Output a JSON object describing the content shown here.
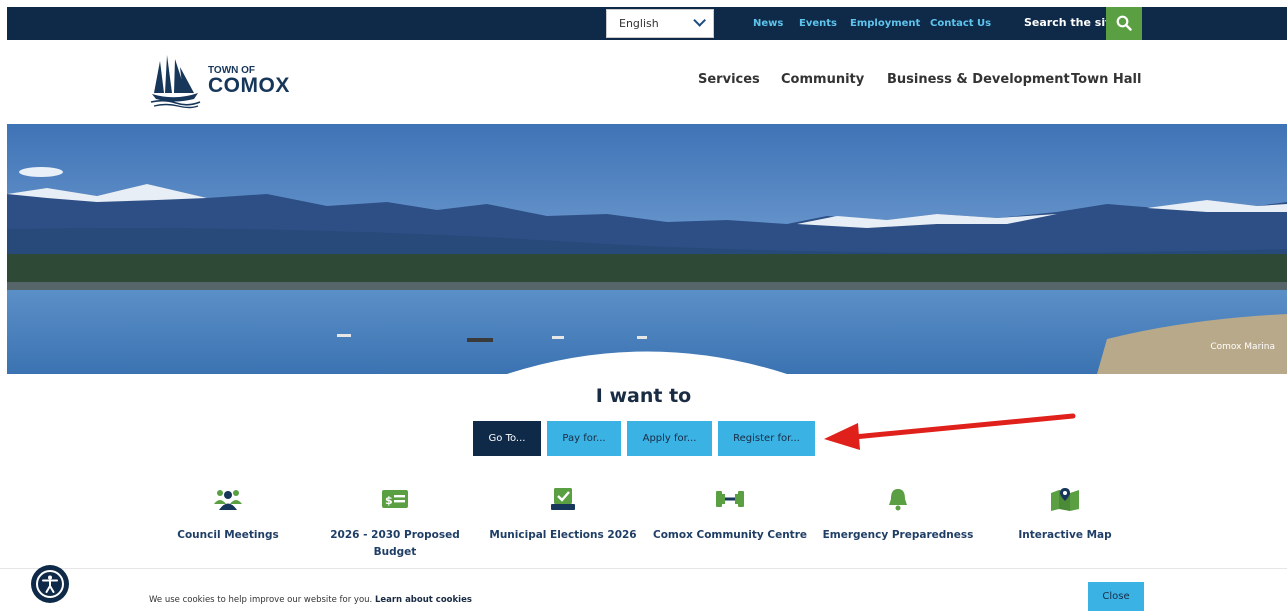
{
  "topbar": {
    "language": "English",
    "links": [
      "News",
      "Events",
      "Employment",
      "Contact Us"
    ],
    "search_label": "Search the site"
  },
  "logo": {
    "line1": "TOWN OF",
    "line2": "COMOX"
  },
  "nav": [
    "Services",
    "Community",
    "Business & Development",
    "Town Hall"
  ],
  "hero": {
    "caption": "Comox Marina"
  },
  "iwant": {
    "heading": "I want to",
    "buttons": [
      "Go To...",
      "Pay for...",
      "Apply for...",
      "Register for..."
    ]
  },
  "quicklinks": [
    {
      "label": "Council Meetings",
      "icon": "people-icon"
    },
    {
      "label": "2026 - 2030 Proposed Budget",
      "icon": "budget-icon"
    },
    {
      "label": "Municipal Elections 2026",
      "icon": "ballot-icon"
    },
    {
      "label": "Comox Community Centre",
      "icon": "dumbbell-icon"
    },
    {
      "label": "Emergency Preparedness",
      "icon": "bell-icon"
    },
    {
      "label": "Interactive Map",
      "icon": "map-icon"
    }
  ],
  "cookie": {
    "message": "We use cookies to help improve our website for you.",
    "link": "Learn about cookies",
    "close": "Close"
  },
  "colors": {
    "navy": "#0e2a48",
    "accent_blue": "#3ab2e4",
    "green": "#5aa043",
    "link_blue": "#5ec4ee"
  }
}
